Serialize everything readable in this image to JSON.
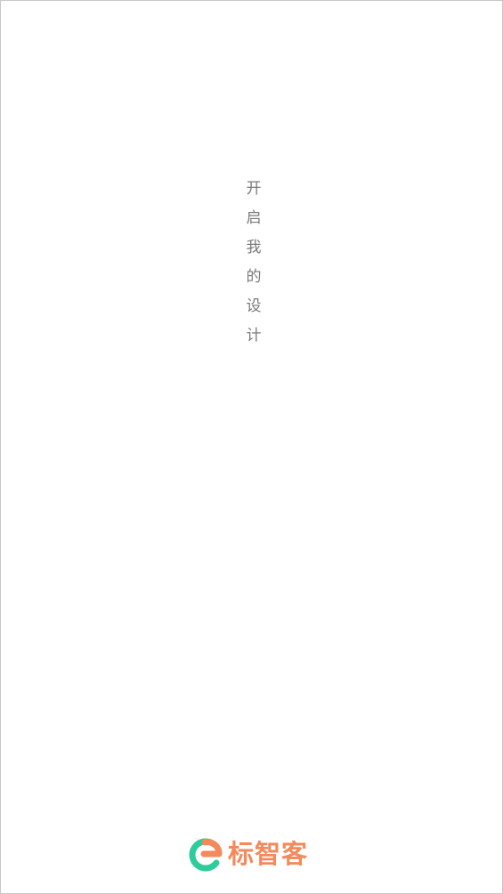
{
  "slogan": {
    "chars": [
      "开",
      "启",
      "我",
      "的",
      "设",
      "计"
    ]
  },
  "brand": {
    "name": "标智客",
    "logo_icon": "brand-e-logo-icon",
    "colors": {
      "logo_green": "#2ecb9c",
      "logo_orange": "#f28a5c",
      "name_orange": "#f28a5c"
    }
  },
  "colors": {
    "background": "#ffffff",
    "slogan_text": "#7a7a7a"
  }
}
